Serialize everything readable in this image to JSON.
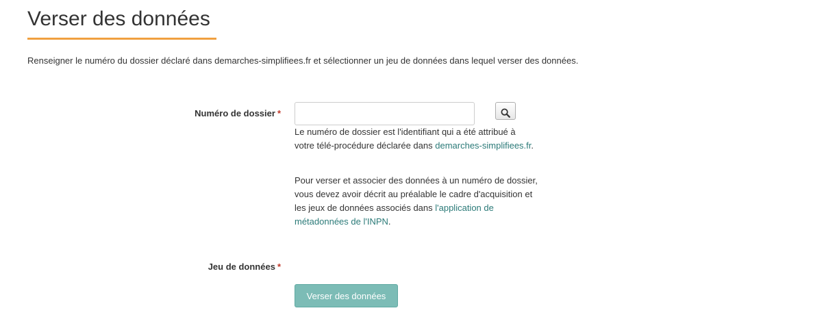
{
  "page": {
    "title": "Verser des données",
    "intro": "Renseigner le numéro du dossier déclaré dans demarches-simplifiees.fr et sélectionner un jeu de données dans lequel verser des données."
  },
  "form": {
    "dossier": {
      "label": "Numéro de dossier",
      "required_mark": "*",
      "value": "",
      "search_icon": "search-icon"
    },
    "help_1": {
      "text": "Le numéro de dossier est l'identifiant qui a été attribué à votre télé-procédure déclarée dans ",
      "link": "demarches-simplifiees.fr",
      "end": "."
    },
    "help_2": {
      "text": "Pour verser et associer des données à un numéro de dossier, vous devez avoir décrit au préalable le cadre d'acquisition et les jeux de données associés dans ",
      "link": "l'application de métadonnées de l'INPN",
      "end": "."
    },
    "jeu": {
      "label": "Jeu de données",
      "required_mark": "*"
    },
    "submit_label": "Verser des données"
  },
  "colors": {
    "accent_underline": "#f0a040",
    "link": "#2b7a78",
    "submit_bg": "#7cbcb6",
    "required": "#c0392b"
  }
}
